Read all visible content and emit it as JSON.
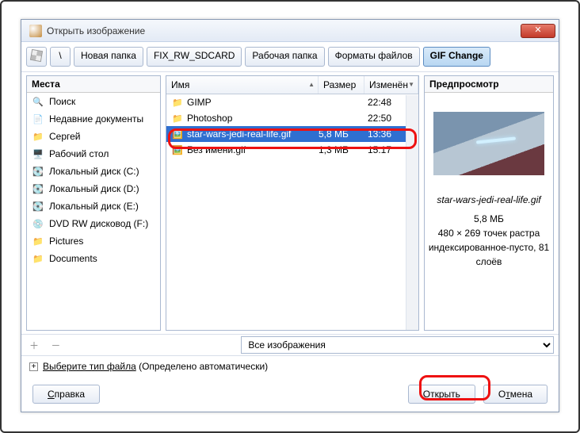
{
  "window": {
    "title": "Открыть изображение"
  },
  "toolbar": {
    "items": [
      "Новая папка",
      "FIX_RW_SDCARD",
      "Рабочая папка",
      "Форматы файлов",
      "GIF Change"
    ]
  },
  "places": {
    "header": "Места",
    "items": [
      {
        "icon": "search",
        "label": "Поиск"
      },
      {
        "icon": "recent",
        "label": "Недавние документы"
      },
      {
        "icon": "folder",
        "label": "Сергей"
      },
      {
        "icon": "desktop",
        "label": "Рабочий стол"
      },
      {
        "icon": "hdd",
        "label": "Локальный диск (C:)"
      },
      {
        "icon": "hdd",
        "label": "Локальный диск (D:)"
      },
      {
        "icon": "hdd",
        "label": "Локальный диск (E:)"
      },
      {
        "icon": "dvd",
        "label": "DVD RW дисковод (F:)"
      },
      {
        "icon": "folder",
        "label": "Pictures"
      },
      {
        "icon": "folder",
        "label": "Documents"
      }
    ]
  },
  "filelist": {
    "columns": {
      "name": "Имя",
      "size": "Размер",
      "date": "Изменён"
    },
    "rows": [
      {
        "icon": "folder",
        "name": "GIMP",
        "size": "",
        "date": "22:48",
        "selected": false
      },
      {
        "icon": "folder",
        "name": "Photoshop",
        "size": "",
        "date": "22:50",
        "selected": false
      },
      {
        "icon": "img",
        "name": "star-wars-jedi-real-life.gif",
        "size": "5,8 МБ",
        "date": "13:36",
        "selected": true
      },
      {
        "icon": "img",
        "name": "Без имени.gif",
        "size": "1,3 МБ",
        "date": "15:17",
        "selected": false
      }
    ]
  },
  "preview": {
    "header": "Предпросмотр",
    "filename": "star-wars-jedi-real-life.gif",
    "size": "5,8 МБ",
    "dims": "480 × 269 точек растра",
    "extra": "индексированное-пусто, 81 слоёв"
  },
  "filter": {
    "selected": "Все изображения"
  },
  "typerow": {
    "label": "Выберите тип файла (Определено автоматически)",
    "expander_label": "Выберите тип файла"
  },
  "buttons": {
    "help": "Справка",
    "open": "Открыть",
    "cancel": "Отмена"
  },
  "annotations": {
    "highlighted_row": "star-wars-jedi-real-life.gif",
    "highlighted_button": "Открыть"
  }
}
